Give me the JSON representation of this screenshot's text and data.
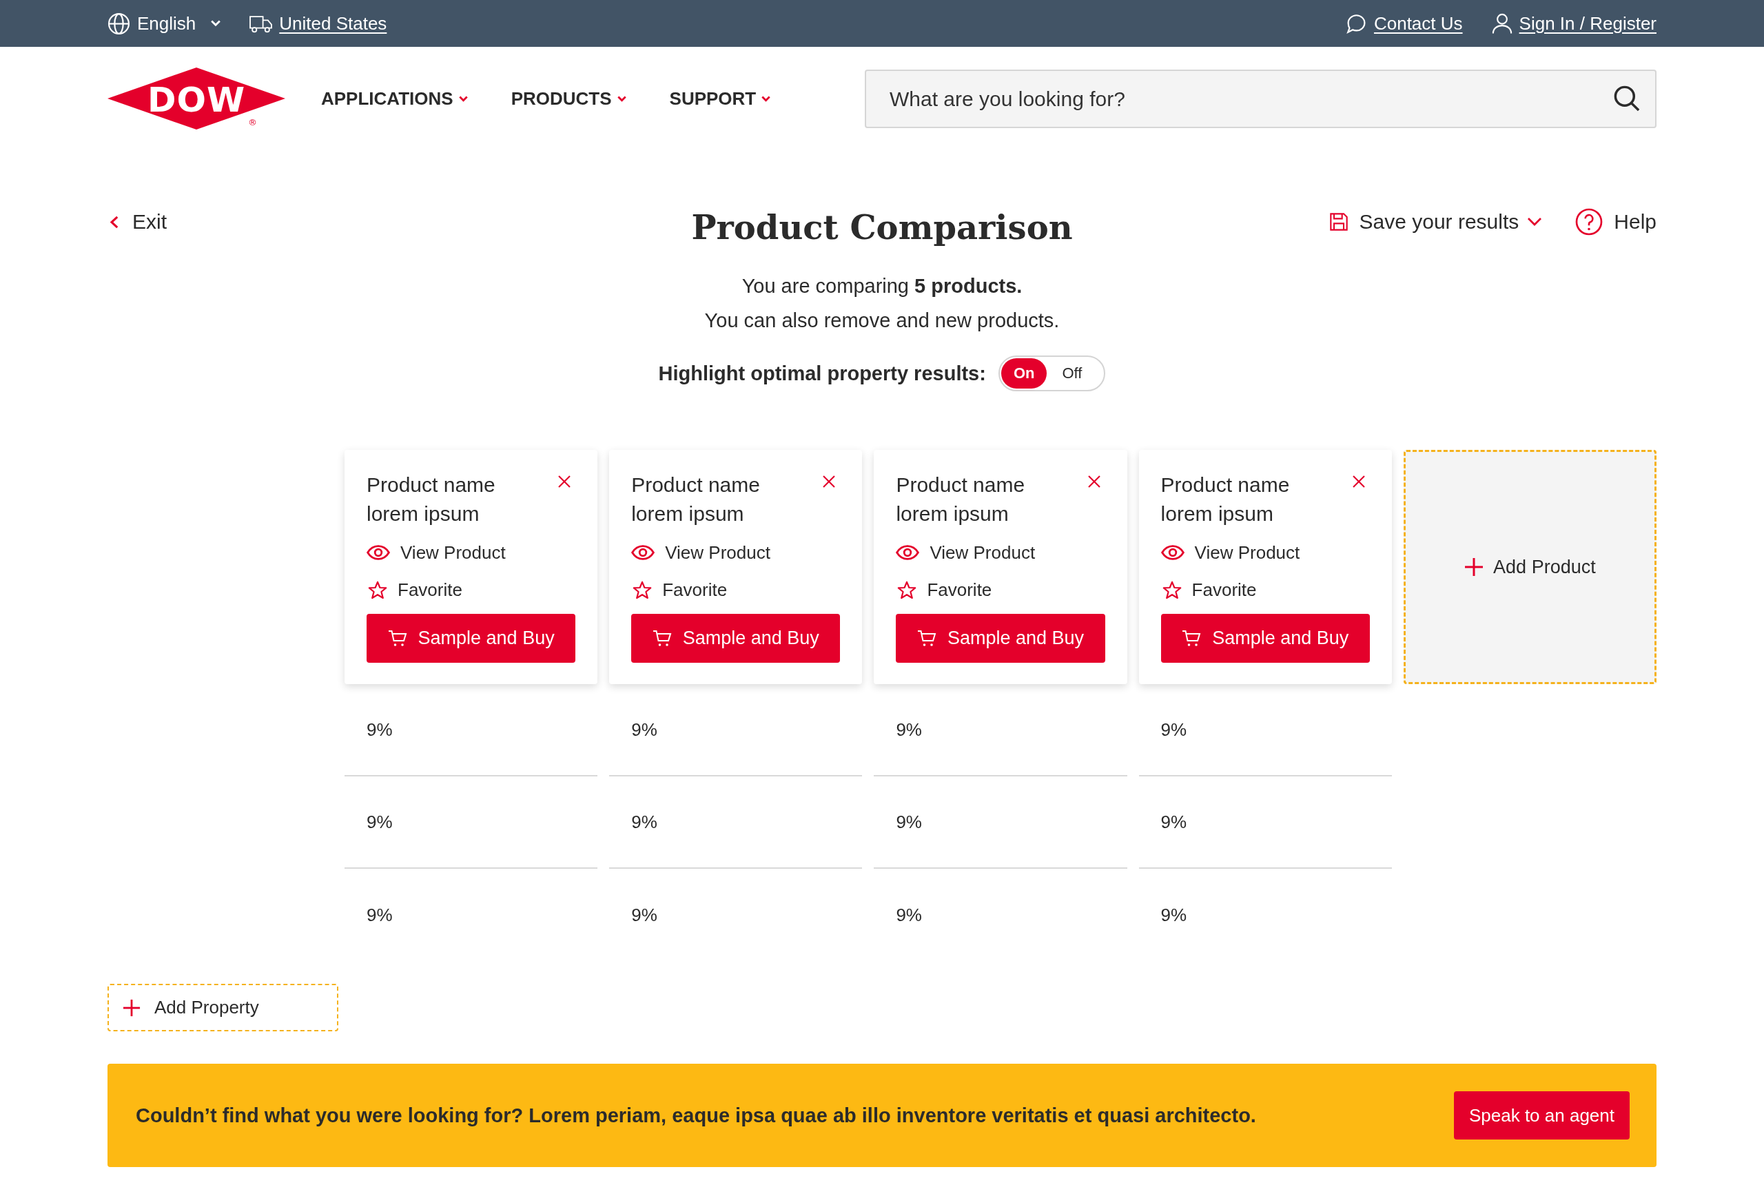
{
  "top_bar": {
    "language": "English",
    "region": "United States",
    "links": [
      {
        "kind": "chat",
        "label": "Contact Us"
      },
      {
        "kind": "user",
        "label": "Sign In / Register"
      }
    ]
  },
  "header": {
    "logo": {
      "text": "DOW",
      "mark": "®"
    },
    "nav": [
      "APPLICATIONS",
      "PRODUCTS",
      "SUPPORT"
    ],
    "search": {
      "placeholder": "What are you looking for?"
    }
  },
  "toolbar": {
    "exit": "Exit",
    "title": "Product Comparison",
    "save": "Save your results",
    "help": "Help"
  },
  "intro": [
    "You are comparing **5 products.**",
    "You can also remove and new products."
  ],
  "highlight": {
    "label": "Highlight optimal property results:",
    "options": [
      {
        "label": "On",
        "selected": true
      },
      {
        "label": "Off",
        "selected": false
      }
    ]
  },
  "products": [
    {
      "name": "Product name lorem ipsum",
      "view": "View Product",
      "favorite": "Favorite",
      "action": "Sample and Buy"
    },
    {
      "name": "Product name lorem ipsum",
      "view": "View Product",
      "favorite": "Favorite",
      "action": "Sample and Buy"
    },
    {
      "name": "Product name lorem ipsum",
      "view": "View Product",
      "favorite": "Favorite",
      "action": "Sample and Buy"
    },
    {
      "name": "Product name lorem ipsum",
      "view": "View Product",
      "favorite": "Favorite",
      "action": "Sample and Buy"
    }
  ],
  "add_product": "Add Product",
  "property_rows": [
    {
      "values": [
        "9%",
        "9%",
        "9%",
        "9%"
      ]
    },
    {
      "values": [
        "9%",
        "9%",
        "9%",
        "9%"
      ]
    },
    {
      "values": [
        "9%",
        "9%",
        "9%",
        "9%"
      ]
    }
  ],
  "add_property": "Add Property",
  "banner": {
    "text": "Couldn’t find what you were looking for? Lorem periam, eaque ipsa quae ab illo inventore veritatis et quasi architecto.",
    "button": "Speak to an agent"
  }
}
